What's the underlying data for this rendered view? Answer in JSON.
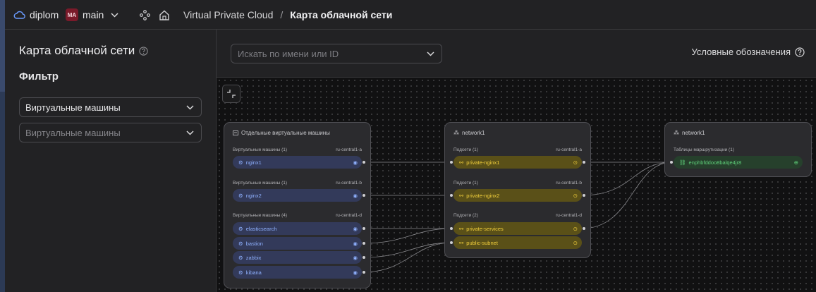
{
  "header": {
    "cloud": "diplom",
    "folder_badge": "МА",
    "folder": "main",
    "service": "Virtual Private Cloud",
    "separator": "/",
    "page": "Карта облачной сети",
    "badge_color": "#7a1a2a"
  },
  "sidebar": {
    "title": "Карта облачной сети",
    "filter_label": "Фильтр",
    "select1_value": "Виртуальные машины",
    "select2_placeholder": "Виртуальные машины"
  },
  "toolbar": {
    "search_placeholder": "Искать по имени или ID",
    "legend_label": "Условные обозначения"
  },
  "map": {
    "vm_group": {
      "title": "Отдельные виртуальные машины",
      "sections": [
        {
          "label": "Виртуальные машины (1)",
          "zone": "ru-central1-a",
          "items": [
            "nginx1"
          ]
        },
        {
          "label": "Виртуальные машины (1)",
          "zone": "ru-central1-b",
          "items": [
            "nginx2"
          ]
        },
        {
          "label": "Виртуальные машины (4)",
          "zone": "ru-central1-d",
          "items": [
            "elasticsearch",
            "bastion",
            "zabbix",
            "kibana"
          ]
        }
      ]
    },
    "net_group": {
      "title": "network1",
      "sections": [
        {
          "label": "Подсети (1)",
          "zone": "ru-central1-a",
          "items": [
            "private-nginx1"
          ]
        },
        {
          "label": "Подсети (1)",
          "zone": "ru-central1-b",
          "items": [
            "private-nginx2"
          ]
        },
        {
          "label": "Подсети (2)",
          "zone": "ru-central1-d",
          "items": [
            "private-services",
            "public-subnet"
          ]
        }
      ]
    },
    "rt_group": {
      "title": "network1",
      "section_label": "Таблицы маршрутизации (1)",
      "item": "enphbfddoo8balqe4jr8"
    },
    "colors": {
      "vm_pill": "#333a5a",
      "subnet_pill": "#5a5018",
      "route_pill": "#26402c"
    }
  }
}
